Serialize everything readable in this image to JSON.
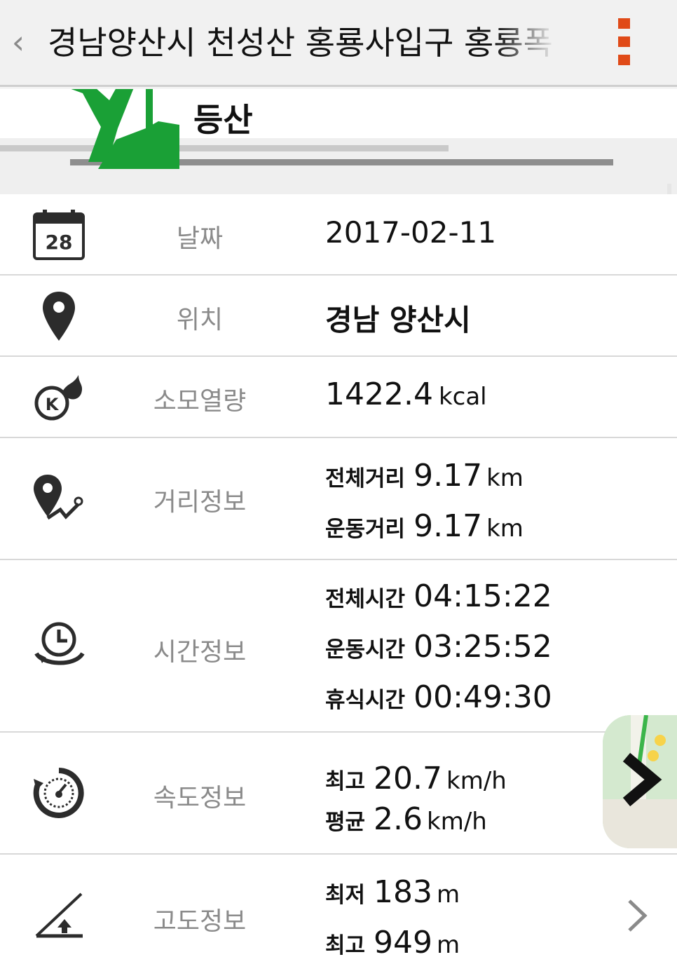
{
  "header": {
    "back_glyph": "‹",
    "title": "경남양산시 천성산 홍룡사입구 홍룡폭",
    "menu_icon": "more-vertical-icon",
    "accent": "#e04a18"
  },
  "banner": {
    "activity": "등산",
    "icon": "hiking-icon",
    "icon_color": "#1aa036"
  },
  "date": {
    "label": "날짜",
    "value": "2017-02-11",
    "icon": "calendar-icon",
    "icon_text": "28"
  },
  "location": {
    "label": "위치",
    "value": "경남 양산시",
    "icon": "location-pin-icon"
  },
  "calories": {
    "label": "소모열량",
    "value": "1422.4",
    "unit": "kcal",
    "icon": "calorie-fire-icon",
    "icon_text": "K"
  },
  "distance": {
    "label": "거리정보",
    "icon": "route-pin-icon",
    "items": [
      {
        "key": "전체거리",
        "value": "9.17",
        "unit": "km"
      },
      {
        "key": "운동거리",
        "value": "9.17",
        "unit": "km"
      }
    ]
  },
  "time": {
    "label": "시간정보",
    "icon": "clock-cycle-icon",
    "items": [
      {
        "key": "전체시간",
        "value": "04:15:22"
      },
      {
        "key": "운동시간",
        "value": "03:25:52"
      },
      {
        "key": "휴식시간",
        "value": "00:49:30"
      }
    ]
  },
  "speed": {
    "label": "속도정보",
    "icon": "speedometer-icon",
    "items": [
      {
        "key": "최고",
        "value": "20.7",
        "unit": "km/h"
      },
      {
        "key": "평균",
        "value": "2.6",
        "unit": "km/h"
      }
    ]
  },
  "altitude": {
    "label": "고도정보",
    "icon": "altitude-icon",
    "chevron": "chevron-right-icon",
    "items": [
      {
        "key": "최저",
        "value": "183",
        "unit": "m"
      },
      {
        "key": "최고",
        "value": "949",
        "unit": "m"
      }
    ]
  },
  "map_thumbnail": {
    "icon": "map-thumbnail",
    "arrow": "arrow-right-icon"
  }
}
